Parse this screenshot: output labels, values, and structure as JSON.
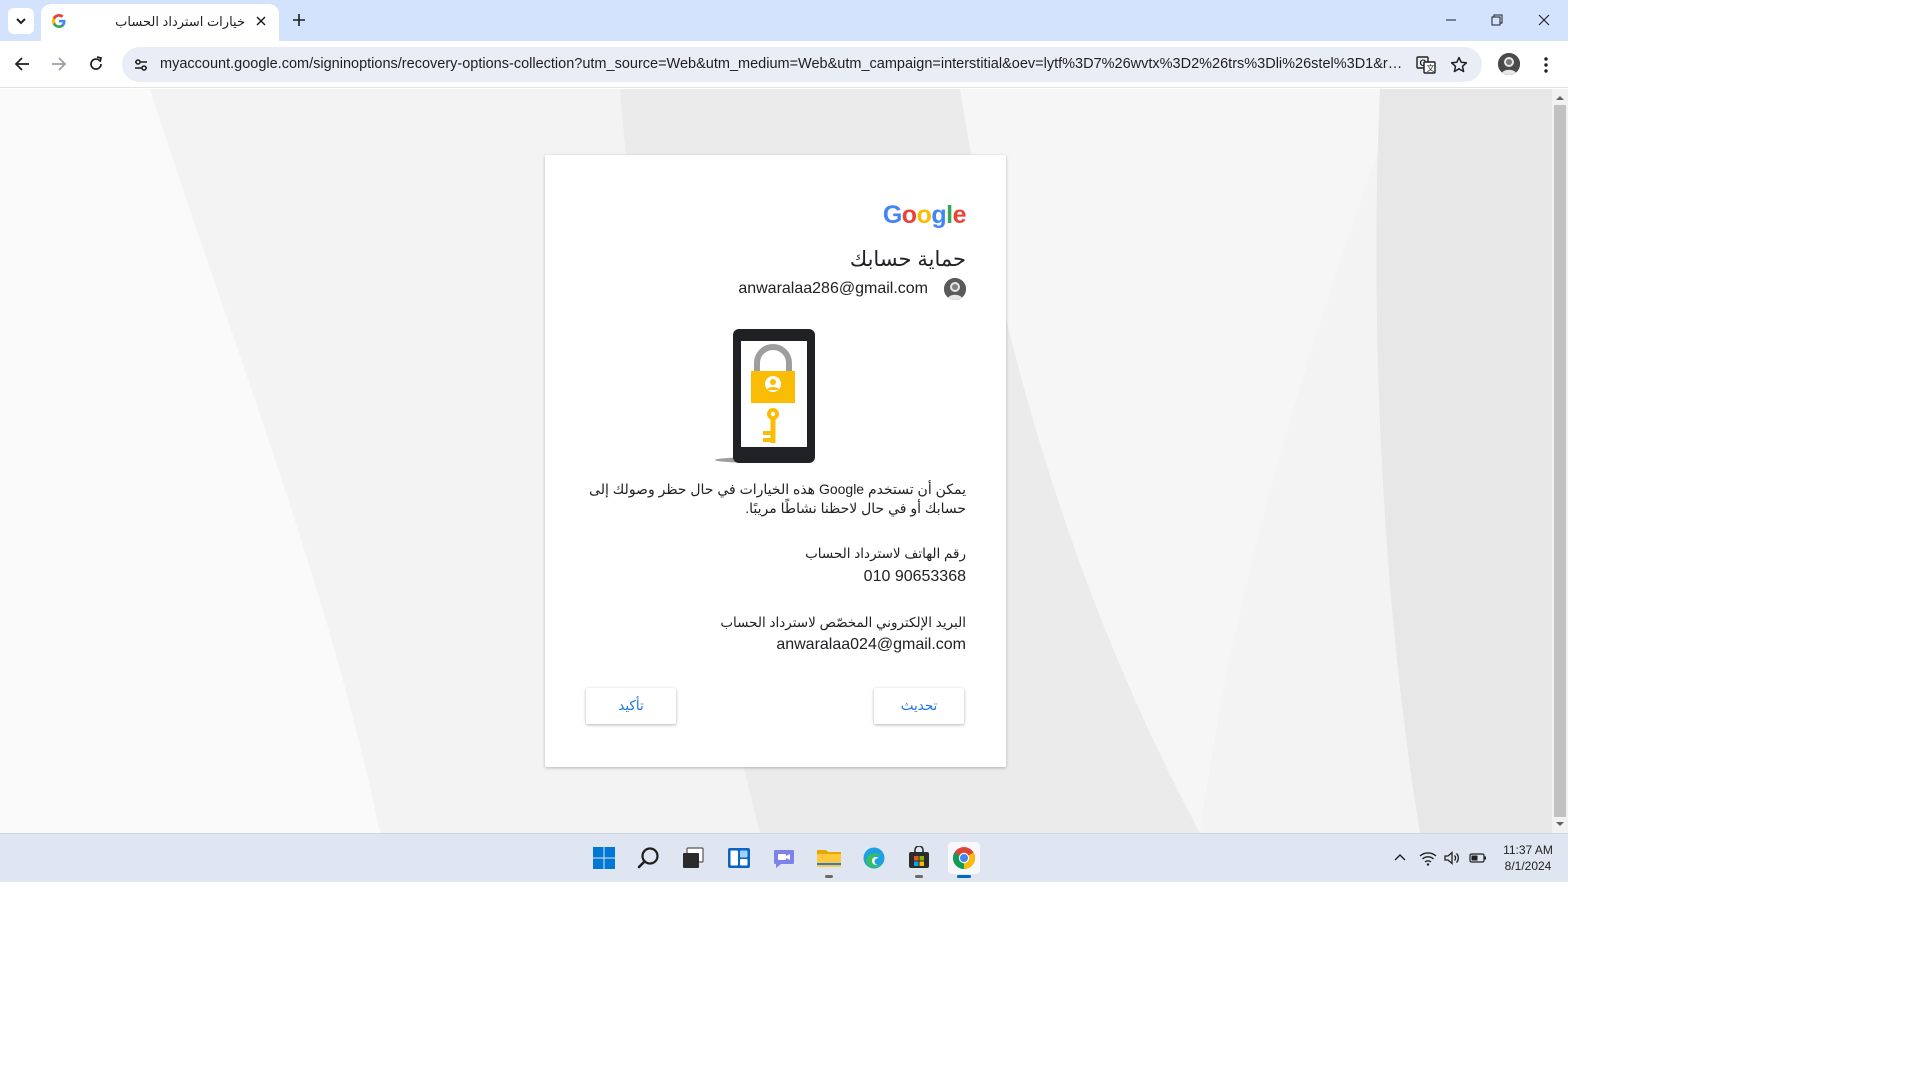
{
  "browser": {
    "tab_title": "خيارات استرداد الحساب",
    "url": "myaccount.google.com/signinoptions/recovery-options-collection?utm_source=Web&utm_medium=Web&utm_campaign=interstitial&oev=lytf%3D7%26wvtx%3D2%26trs%3Dli%26stel%3D1&ra..."
  },
  "card": {
    "logo_letters": [
      "G",
      "o",
      "o",
      "g",
      "l",
      "e"
    ],
    "heading": "حماية حسابك",
    "account_email": "anwaralaa286@gmail.com",
    "description": "يمكن أن تستخدم Google هذه الخيارات في حال حظر وصولك إلى حسابك أو في حال لاحظنا نشاطًا مريبًا.",
    "phone_label": "رقم الهاتف لاسترداد الحساب",
    "phone_value": "010 90653368",
    "email_label": "البريد الإلكتروني المخصّص لاسترداد الحساب",
    "email_value": "anwaralaa024@gmail.com",
    "update_button": "تحديث",
    "confirm_button": "تأكيد"
  },
  "taskbar": {
    "apps": [
      "start-icon",
      "search-icon",
      "task-view-icon",
      "widgets-icon",
      "teams-chat-icon",
      "file-explorer-icon",
      "edge-icon",
      "store-icon",
      "chrome-icon"
    ],
    "time": "11:37 AM",
    "date": "8/1/2024"
  },
  "colors": {
    "google_blue": "#4285F4",
    "google_red": "#EA4335",
    "google_yellow": "#FBBC05",
    "google_green": "#34A853",
    "link_blue": "#1a73e8",
    "tabstrip": "#d3e3fd"
  }
}
